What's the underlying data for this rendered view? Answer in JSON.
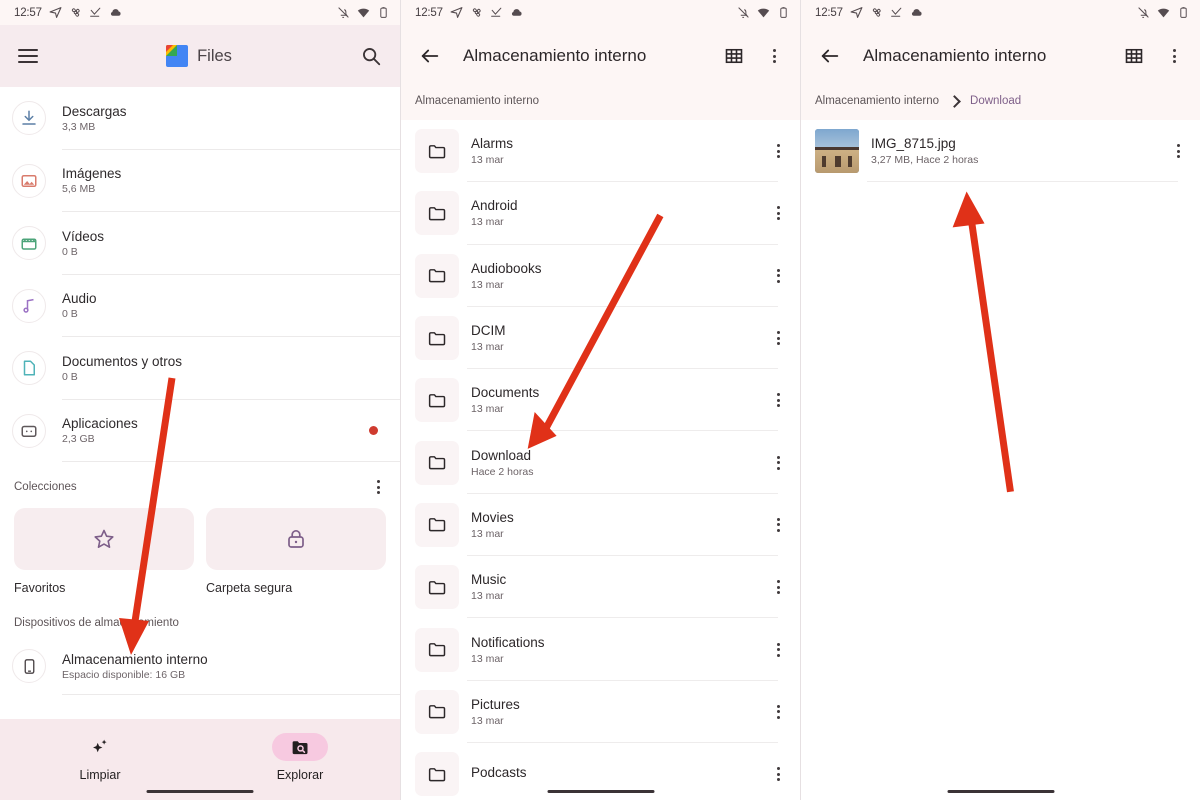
{
  "statusbar": {
    "time": "12:57",
    "left_icons": [
      "navigation-icon",
      "fan-icon",
      "check-download-icon",
      "cloud-icon"
    ],
    "right_icons": [
      "notifications-off-icon",
      "wifi-icon",
      "battery-icon"
    ]
  },
  "panel_left": {
    "appbar": {
      "menu_label": "menu-icon",
      "app_title": "Files",
      "search_label": "search-icon"
    },
    "categories": [
      {
        "name": "Descargas",
        "size": "3,3 MB",
        "icon": "download-icon",
        "color": "#5b7fa6",
        "badge": false
      },
      {
        "name": "Imágenes",
        "size": "5,6 MB",
        "icon": "image-icon",
        "color": "#d97b6c",
        "badge": false
      },
      {
        "name": "Vídeos",
        "size": "0 B",
        "icon": "video-icon",
        "color": "#4da47a",
        "badge": false
      },
      {
        "name": "Audio",
        "size": "0 B",
        "icon": "music-note-icon",
        "color": "#9b72c4",
        "badge": false
      },
      {
        "name": "Documentos y otros",
        "size": "0 B",
        "icon": "document-icon",
        "color": "#4fb3b8",
        "badge": false
      },
      {
        "name": "Aplicaciones",
        "size": "2,3 GB",
        "icon": "apps-icon",
        "color": "#5f585b",
        "badge": true
      }
    ],
    "collections_header": "Colecciones",
    "collections": [
      {
        "label": "Favoritos",
        "icon": "star-icon"
      },
      {
        "label": "Carpeta segura",
        "icon": "lock-icon"
      }
    ],
    "devices_header": "Dispositivos de almacenamiento",
    "device": {
      "name": "Almacenamiento interno",
      "sub": "Espacio disponible: 16 GB",
      "icon": "phone-icon"
    },
    "bottomnav": [
      {
        "label": "Limpiar",
        "icon": "sparkle-icon",
        "active": false
      },
      {
        "label": "Explorar",
        "icon": "folder-search-icon",
        "active": true
      }
    ]
  },
  "panel_mid": {
    "appbar": {
      "back": "back-arrow-icon",
      "title": "Almacenamiento interno",
      "grid": "grid-view-icon",
      "more": "more-vert-icon"
    },
    "breadcrumb": [
      {
        "label": "Almacenamiento interno",
        "link": false
      }
    ],
    "files": [
      {
        "name": "Alarms",
        "meta": "13 mar"
      },
      {
        "name": "Android",
        "meta": "13 mar"
      },
      {
        "name": "Audiobooks",
        "meta": "13 mar"
      },
      {
        "name": "DCIM",
        "meta": "13 mar"
      },
      {
        "name": "Documents",
        "meta": "13 mar"
      },
      {
        "name": "Download",
        "meta": "Hace 2 horas"
      },
      {
        "name": "Movies",
        "meta": "13 mar"
      },
      {
        "name": "Music",
        "meta": "13 mar"
      },
      {
        "name": "Notifications",
        "meta": "13 mar"
      },
      {
        "name": "Pictures",
        "meta": "13 mar"
      },
      {
        "name": "Podcasts",
        "meta": ""
      }
    ]
  },
  "panel_right": {
    "appbar": {
      "back": "back-arrow-icon",
      "title": "Almacenamiento interno",
      "grid": "grid-view-icon",
      "more": "more-vert-icon"
    },
    "breadcrumb": [
      {
        "label": "Almacenamiento interno",
        "link": false
      },
      {
        "label": "Download",
        "link": true
      }
    ],
    "files": [
      {
        "name": "IMG_8715.jpg",
        "meta": "3,27 MB, Hace 2 horas",
        "thumb": "photo-thumbnail"
      }
    ]
  },
  "annotations": {
    "color": "#e03118",
    "arrows": [
      {
        "name": "arrow-to-internal-storage"
      },
      {
        "name": "arrow-to-download-folder"
      },
      {
        "name": "arrow-to-image-file"
      }
    ]
  }
}
